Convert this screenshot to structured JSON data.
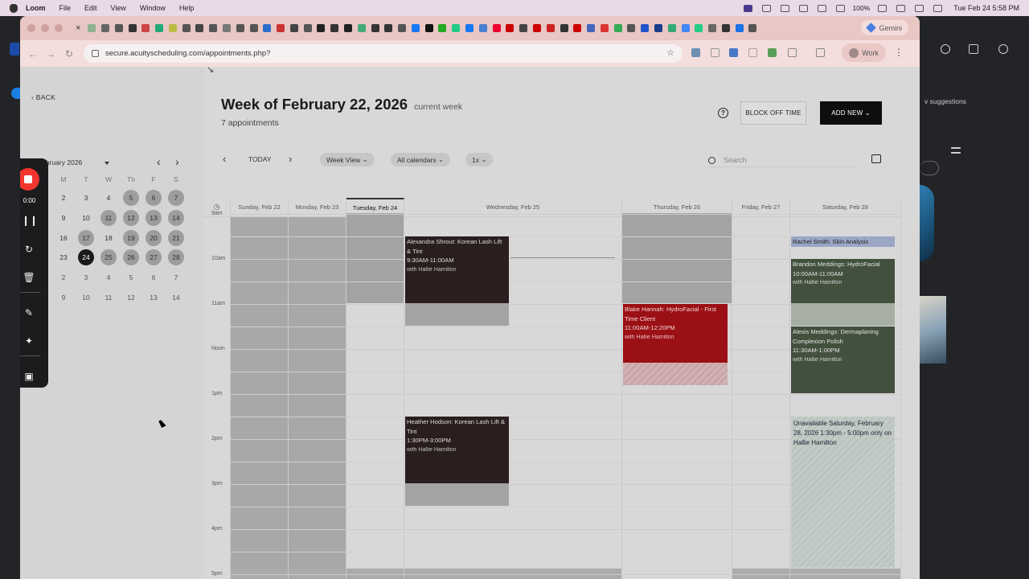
{
  "menubar": {
    "app": "Loom",
    "items": [
      "File",
      "Edit",
      "View",
      "Window",
      "Help"
    ],
    "battery": "100%",
    "datetime": "Tue Feb 24  5:58 PM"
  },
  "browser": {
    "gemini": "Gemini",
    "url": "secure.acuityscheduling.com/appointments.php?",
    "profile": "Work"
  },
  "sidebar": {
    "back": "BACK",
    "month_label": "February 2026",
    "weekday_headers": [
      "M",
      "T",
      "W",
      "Th",
      "F",
      "S"
    ],
    "weeks": [
      [
        "2",
        "3",
        "4",
        "5",
        "6",
        "7"
      ],
      [
        "9",
        "10",
        "11",
        "12",
        "13",
        "14"
      ],
      [
        "16",
        "17",
        "18",
        "19",
        "20",
        "21"
      ],
      [
        "23",
        "24",
        "25",
        "26",
        "27",
        "28"
      ],
      [
        "2",
        "3",
        "4",
        "5",
        "6",
        "7"
      ],
      [
        "9",
        "10",
        "11",
        "12",
        "13",
        "14"
      ]
    ]
  },
  "loom": {
    "timer": "0:00"
  },
  "header": {
    "title": "Week of February 22, 2026",
    "current": "current week",
    "count": "7 appointments",
    "help": "?",
    "block_off": "BLOCK OFF TIME",
    "add_new": "ADD NEW"
  },
  "toolbar": {
    "today": "TODAY",
    "view": "Week View",
    "calendars": "All calendars",
    "zoom": "1x",
    "search_placeholder": "Search"
  },
  "days": [
    "Sunday, Feb 22",
    "Monday, Feb 23",
    "Tuesday, Feb 24",
    "Wednesday, Feb 25",
    "Thursday, Feb 26",
    "Friday, Feb 27",
    "Saturday, Feb 28"
  ],
  "times": [
    "9am",
    "10am",
    "11am",
    "Noon",
    "1pm",
    "2pm",
    "3pm",
    "4pm",
    "5pm"
  ],
  "events": [
    {
      "name": "Alexandra Shrout:",
      "service": "Korean Lash Lift & Tint",
      "time": "9:30AM-11:00AM",
      "with": "with Hallie Hamilton"
    },
    {
      "name": "Heather Hodson:",
      "service": "Korean Lash Lift & Tint",
      "time": "1:30PM-3:00PM",
      "with": "with Hallie Hamilton"
    },
    {
      "name": "Blake Hannah:",
      "service": "HydroFacial - First Time Client",
      "time": "11:00AM-12:20PM",
      "with": "with Hallie Hamilton"
    },
    {
      "name": "Rachel Smith:",
      "service": "Skin Analysis",
      "time": "",
      "with": ""
    },
    {
      "name": "Brandon Meddings:",
      "service": "HydroFacial",
      "time": "10:00AM-11:00AM",
      "with": "with Hallie Hamilton"
    },
    {
      "name": "Alexis Meddings:",
      "service": "Dermaplaning Complexion Polish",
      "time": "11:30AM-1:00PM",
      "with": "with Hallie Hamilton"
    }
  ],
  "unavailable": "Unavailable Saturday, February 28, 2026 1:30pm - 5:00pm only on Hallie Hamilton",
  "right_panel": {
    "suggestions": "v suggestions"
  },
  "colors": {
    "menubar": "#ead9e6",
    "tabstrip": "#e8c7c5",
    "appt_dark": "#2a1e1f",
    "appt_red": "#9b1014",
    "appt_green": "#42503e",
    "loom_record": "#f2352e"
  }
}
